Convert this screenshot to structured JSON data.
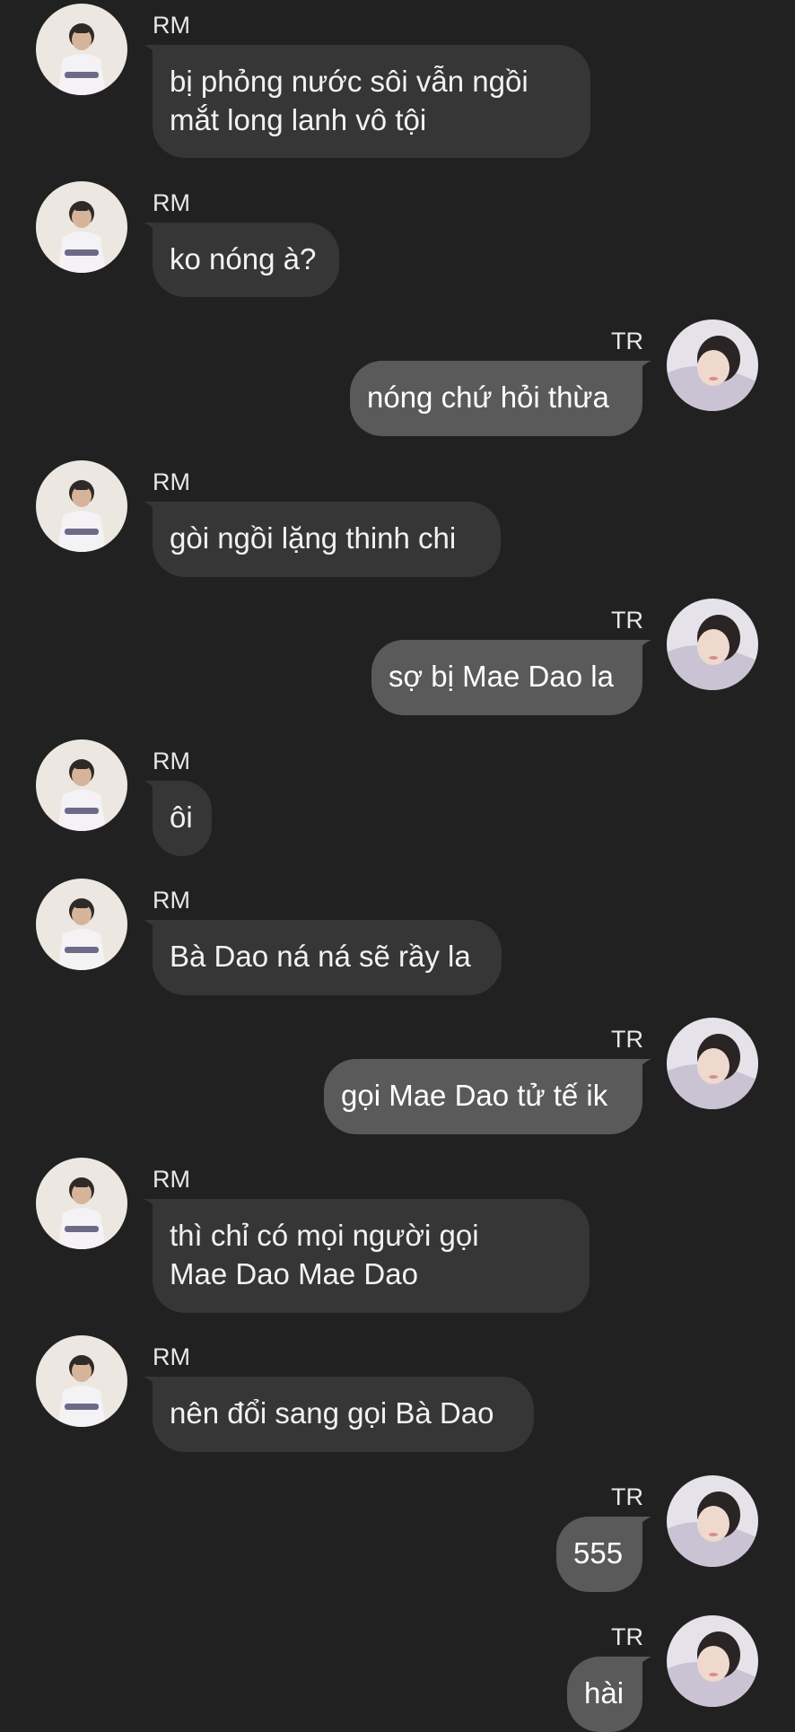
{
  "chat": {
    "messages": [
      {
        "sender": "RM",
        "direction": "in",
        "text": "bị phỏng nước sôi vẫn ngồi\nmắt long lanh vô tội"
      },
      {
        "sender": "RM",
        "direction": "in",
        "text": "ko nóng à?"
      },
      {
        "sender": "TR",
        "direction": "out",
        "text": "nóng chứ hỏi thừa"
      },
      {
        "sender": "RM",
        "direction": "in",
        "text": "gòi ngồi lặng thinh chi"
      },
      {
        "sender": "TR",
        "direction": "out",
        "text": "sợ bị Mae Dao la"
      },
      {
        "sender": "RM",
        "direction": "in",
        "text": "ôi"
      },
      {
        "sender": "RM",
        "direction": "in",
        "text": "Bà Dao ná ná sẽ rầy la"
      },
      {
        "sender": "TR",
        "direction": "out",
        "text": "gọi Mae Dao tử tế ik"
      },
      {
        "sender": "RM",
        "direction": "in",
        "text": "thì chỉ có mọi người gọi\nMae Dao Mae Dao"
      },
      {
        "sender": "RM",
        "direction": "in",
        "text": "nên đổi sang gọi Bà Dao"
      },
      {
        "sender": "TR",
        "direction": "out",
        "text": "555"
      },
      {
        "sender": "TR",
        "direction": "out",
        "text": "hài"
      }
    ]
  },
  "colors": {
    "background": "#212121",
    "incoming_bubble": "#363636",
    "outgoing_bubble": "#5a5a5a",
    "text": "#f2f2f2"
  },
  "icons": {
    "rm_avatar": "profile-photo-rm",
    "tr_avatar": "profile-photo-tr"
  }
}
